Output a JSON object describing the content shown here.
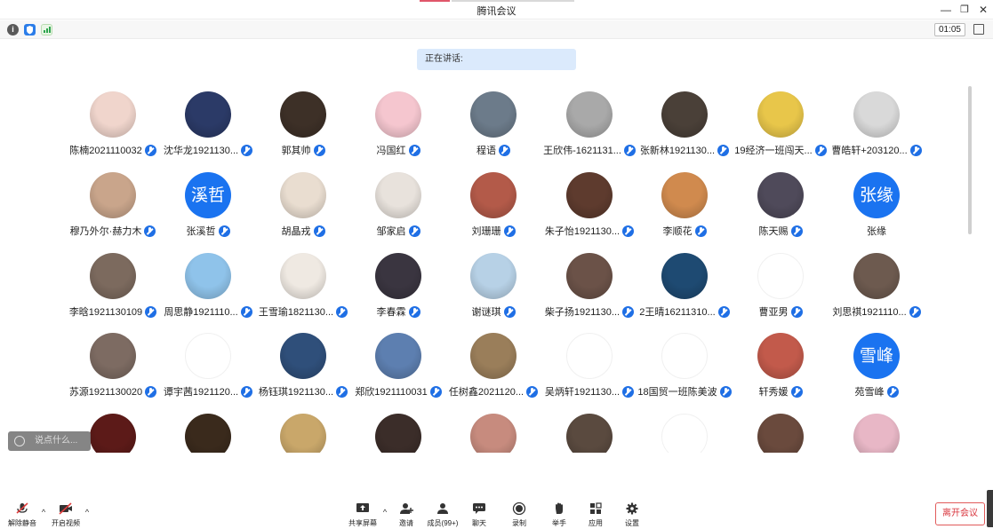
{
  "window": {
    "title": "腾讯会议",
    "minimize_icon": "minimize-icon",
    "restore_icon": "restore-icon",
    "close_icon": "close-icon"
  },
  "infobar": {
    "timer": "01:05"
  },
  "speaking": {
    "label": "正在讲话:"
  },
  "participants": [
    {
      "name": "陈楠2021110032",
      "avatar_color": "#f0d5cc"
    },
    {
      "name": "沈华龙1921130...",
      "avatar_color": "#2b3a67"
    },
    {
      "name": "郭其帅",
      "avatar_color": "#3d3027"
    },
    {
      "name": "冯国红",
      "avatar_color": "#f5c6cf"
    },
    {
      "name": "程语",
      "avatar_color": "#6c7b8a"
    },
    {
      "name": "王欣伟-1621131...",
      "avatar_color": "#a9a9a9"
    },
    {
      "name": "张新林1921130...",
      "avatar_color": "#4a4038"
    },
    {
      "name": "19经济一班闯天...",
      "avatar_color": "#e8c64a"
    },
    {
      "name": "曹皓轩+203120...",
      "avatar_color": "#d9d9d9"
    },
    {
      "name": "穆乃外尔·赫力木",
      "avatar_color": "#c9a58b"
    },
    {
      "name": "张溪哲",
      "avatar_text": "溪哲"
    },
    {
      "name": "胡晶戎",
      "avatar_color": "#e9ddd0"
    },
    {
      "name": "邹家启",
      "avatar_color": "#e8e2dc"
    },
    {
      "name": "刘珊珊",
      "avatar_color": "#b35a49"
    },
    {
      "name": "朱子怡1921130...",
      "avatar_color": "#5e3b2e"
    },
    {
      "name": "李顺花",
      "avatar_color": "#d08a4e"
    },
    {
      "name": "陈天赐",
      "avatar_color": "#4f4a5a"
    },
    {
      "name": "张缘",
      "avatar_text": "张缘",
      "no_mic": true
    },
    {
      "name": "李晗1921130109",
      "avatar_color": "#7c6a5e"
    },
    {
      "name": "周思静1921110...",
      "avatar_color": "#8fc3ea"
    },
    {
      "name": "王雪瑜1821130...",
      "avatar_color": "#efe9e2"
    },
    {
      "name": "李春霖",
      "avatar_color": "#3a3540"
    },
    {
      "name": "谢谜琪",
      "avatar_color": "#b7d1e6"
    },
    {
      "name": "柴子扬1921130...",
      "avatar_color": "#6b5248"
    },
    {
      "name": "2王晴16211310...",
      "avatar_color": "#1e4a72"
    },
    {
      "name": "曹亚男",
      "avatar_color": "#ffffff"
    },
    {
      "name": "刘思祺1921110...",
      "avatar_color": "#6d5a4f"
    },
    {
      "name": "苏源1921130020",
      "avatar_color": "#7d6b62"
    },
    {
      "name": "谭宇茜1921120...",
      "avatar_color": "#ffffff"
    },
    {
      "name": "杨钰琪1921130...",
      "avatar_color": "#2f4f7a"
    },
    {
      "name": "郑欣1921110031",
      "avatar_color": "#5d7fb0"
    },
    {
      "name": "任树鑫2021120...",
      "avatar_color": "#9a7e5a"
    },
    {
      "name": "吴炳轩1921130...",
      "avatar_color": "#ffffff"
    },
    {
      "name": "18国贸一班陈美波",
      "avatar_color": "#ffffff"
    },
    {
      "name": "轩秀媛",
      "avatar_color": "#c25a4b"
    },
    {
      "name": "苑雪峰",
      "avatar_text": "雪峰"
    },
    {
      "name": "",
      "avatar_color": "#5c1a18"
    },
    {
      "name": "",
      "avatar_color": "#3a2a1c"
    },
    {
      "name": "",
      "avatar_color": "#c9a76a"
    },
    {
      "name": "",
      "avatar_color": "#3b2d29"
    },
    {
      "name": "",
      "avatar_color": "#c78b7e"
    },
    {
      "name": "",
      "avatar_color": "#5a4a3f"
    },
    {
      "name": "",
      "avatar_color": "#ffffff"
    },
    {
      "name": "",
      "avatar_color": "#6a4a3d"
    },
    {
      "name": "",
      "avatar_color": "#e8b7c6"
    }
  ],
  "chat": {
    "placeholder": "说点什么..."
  },
  "toolbar": {
    "unmute": "解除静音",
    "start_video": "开启视频",
    "share_screen": "共享屏幕",
    "invite": "邀请",
    "members": "成员(99+)",
    "chat": "聊天",
    "record": "录制",
    "raise_hand": "举手",
    "apps": "应用",
    "settings": "设置",
    "leave": "离开会议"
  },
  "colors": {
    "accent": "#1f6fe5",
    "leave": "#d9363e",
    "speaking_bg": "#dbeafc"
  }
}
